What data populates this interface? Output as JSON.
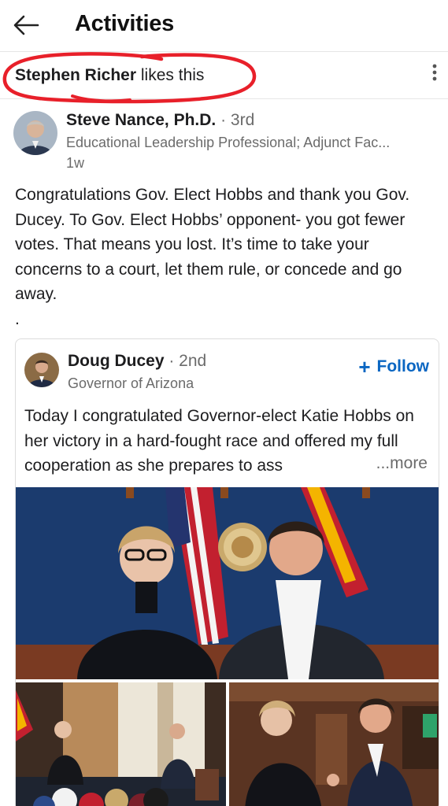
{
  "header": {
    "title": "Activities"
  },
  "activity": {
    "actor": "Stephen Richer",
    "action": "likes this"
  },
  "post": {
    "author": "Steve Nance, Ph.D.",
    "degree": " · 3rd",
    "headline": "Educational Leadership Professional; Adjunct Fac...",
    "time": "1w",
    "body": "Congratulations Gov. Elect Hobbs and thank you Gov. Ducey.  To Gov. Elect Hobbs’ opponent- you got fewer votes.  That means you lost.  It’s time to take your concerns to a court, let them rule, or concede and go away.",
    "trailing": "."
  },
  "shared": {
    "author": "Doug Ducey",
    "degree": " · 2nd",
    "headline": "Governor of Arizona",
    "follow_label": "Follow",
    "text": "Today I congratulated Governor-elect Katie Hobbs on her victory in a hard-fought race and offered my full cooperation as she prepares to ass",
    "more_label": "...more"
  },
  "colors": {
    "link": "#0a66c2",
    "annotation": "#e8202a",
    "secondary_text": "#6b6b6b"
  },
  "icons": [
    "back-arrow-icon",
    "more-options-icon",
    "plus-icon"
  ]
}
